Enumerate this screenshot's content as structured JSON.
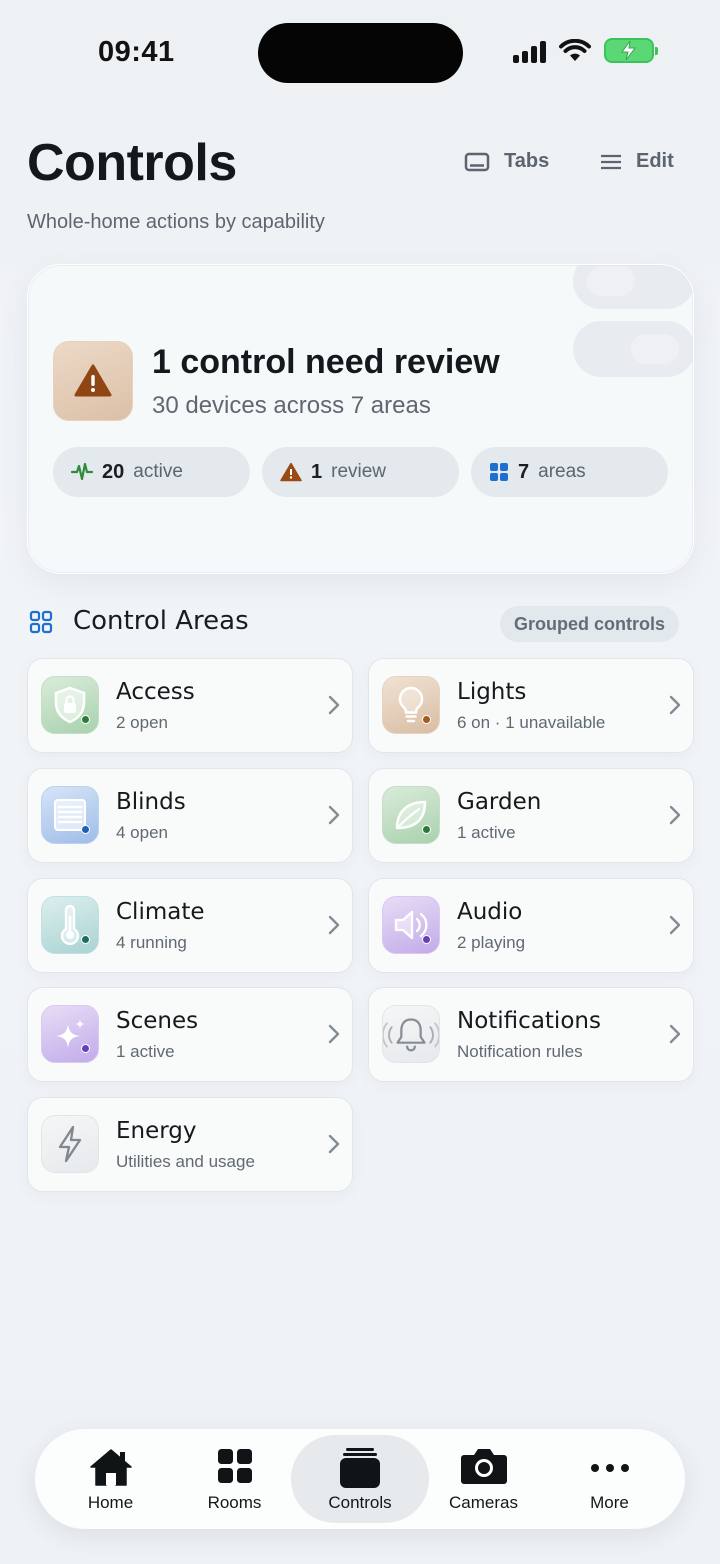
{
  "status_bar": {
    "time": "09:41"
  },
  "header": {
    "title": "Controls",
    "subtitle": "Whole-home actions by capability",
    "tabs_label": "Tabs",
    "edit_label": "Edit"
  },
  "summary": {
    "title": "1 control need review",
    "subtitle": "30 devices across 7 areas",
    "stats": [
      {
        "value": "20",
        "label": "active",
        "icon": "activity-icon",
        "color": "#2e8b3e"
      },
      {
        "value": "1",
        "label": "review",
        "icon": "warning-icon",
        "color": "#9a4a12"
      },
      {
        "value": "7",
        "label": "areas",
        "icon": "grid-icon",
        "color": "#1f6fd1"
      }
    ]
  },
  "section": {
    "title": "Control Areas",
    "badge": "Grouped controls"
  },
  "areas": [
    {
      "title": "Access",
      "subtitle": "2 open",
      "icon": "shield-lock-icon",
      "dot": "#2b7a3a"
    },
    {
      "title": "Lights",
      "subtitle": "6 on · 1 unavailable",
      "icon": "bulb-icon",
      "dot": "#a55a18"
    },
    {
      "title": "Blinds",
      "subtitle": "4 open",
      "icon": "blinds-icon",
      "dot": "#1f5fb8"
    },
    {
      "title": "Garden",
      "subtitle": "1 active",
      "icon": "leaf-icon",
      "dot": "#2b7a3a"
    },
    {
      "title": "Climate",
      "subtitle": "4 running",
      "icon": "thermometer-icon",
      "dot": "#1e6b66"
    },
    {
      "title": "Audio",
      "subtitle": "2 playing",
      "icon": "speaker-icon",
      "dot": "#6a3db8"
    },
    {
      "title": "Scenes",
      "subtitle": "1 active",
      "icon": "sparkle-icon",
      "dot": "#6a3db8"
    },
    {
      "title": "Notifications",
      "subtitle": "Notification rules",
      "icon": "bell-icon",
      "dot": ""
    },
    {
      "title": "Energy",
      "subtitle": "Utilities and usage",
      "icon": "lightning-icon",
      "dot": ""
    }
  ],
  "tabbar": {
    "items": [
      {
        "label": "Home",
        "icon": "home-icon"
      },
      {
        "label": "Rooms",
        "icon": "rooms-grid-icon"
      },
      {
        "label": "Controls",
        "icon": "controls-stack-icon",
        "active": true
      },
      {
        "label": "Cameras",
        "icon": "camera-icon"
      },
      {
        "label": "More",
        "icon": "more-dots-icon"
      }
    ]
  }
}
